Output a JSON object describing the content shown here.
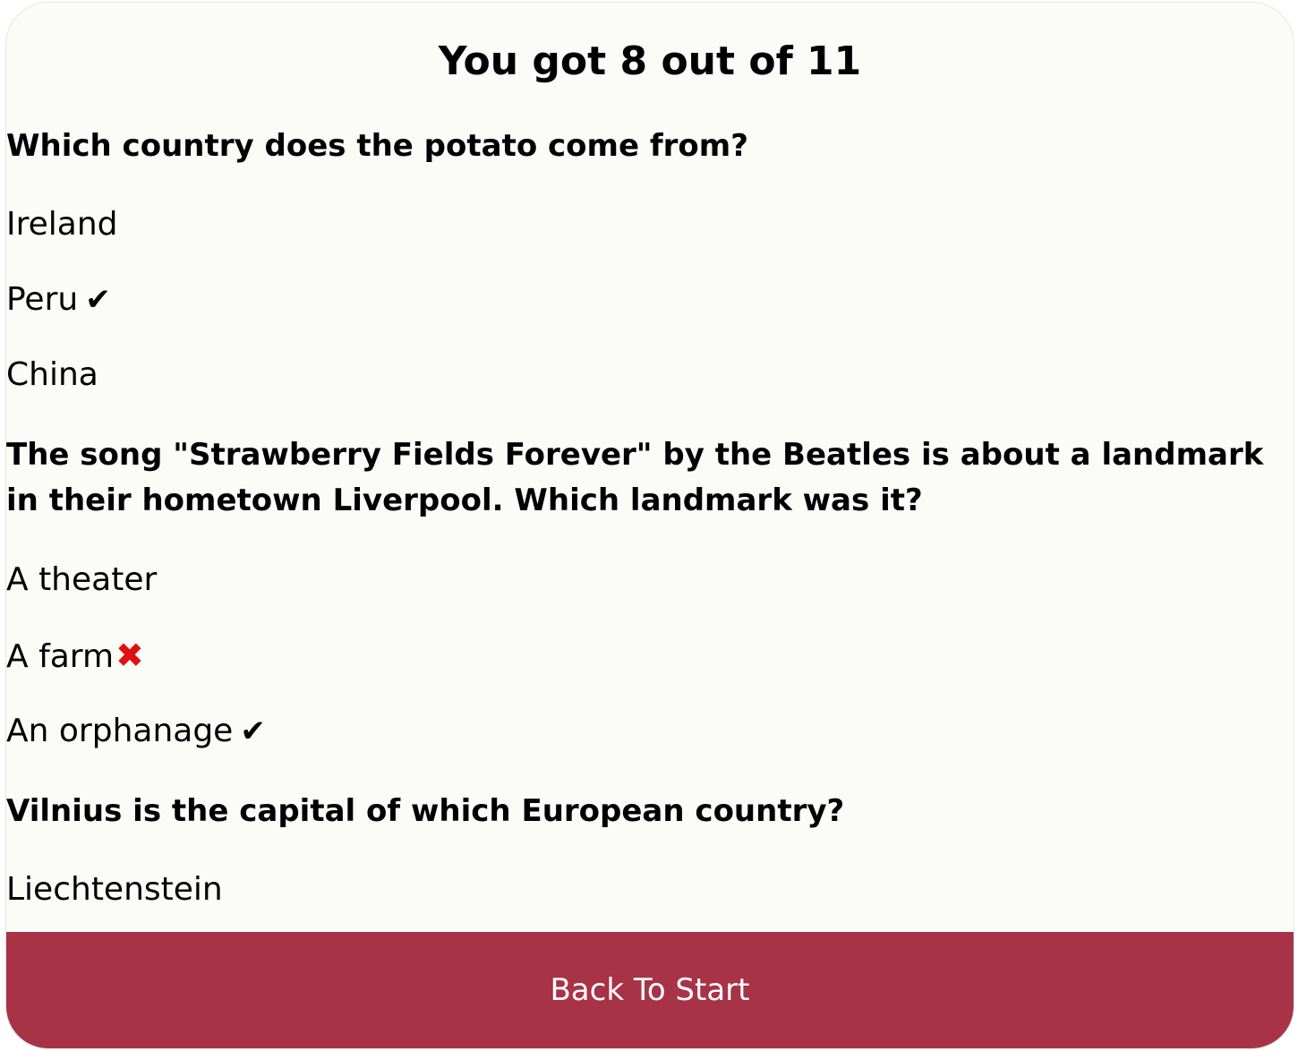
{
  "score_title": "You got 8 out of 11",
  "questions": [
    {
      "text": "Which country does the potato come from?",
      "answers": [
        {
          "label": "Ireland",
          "mark": ""
        },
        {
          "label": "Peru",
          "mark": "✔"
        },
        {
          "label": "China",
          "mark": ""
        }
      ]
    },
    {
      "text": "The song \"Strawberry Fields Forever\" by the Beatles is about a landmark in their hometown Liverpool. Which landmark was it?",
      "answers": [
        {
          "label": "A theater",
          "mark": ""
        },
        {
          "label": "A farm",
          "mark": "✖"
        },
        {
          "label": "An orphanage",
          "mark": "✔"
        }
      ]
    },
    {
      "text": "Vilnius is the capital of which European country?",
      "answers": [
        {
          "label": "Liechtenstein",
          "mark": ""
        }
      ]
    }
  ],
  "back_button_label": "Back To Start",
  "colors": {
    "card_background": "#fbfcf8",
    "button_background": "#a83246",
    "wrong_mark": "#e01010"
  }
}
